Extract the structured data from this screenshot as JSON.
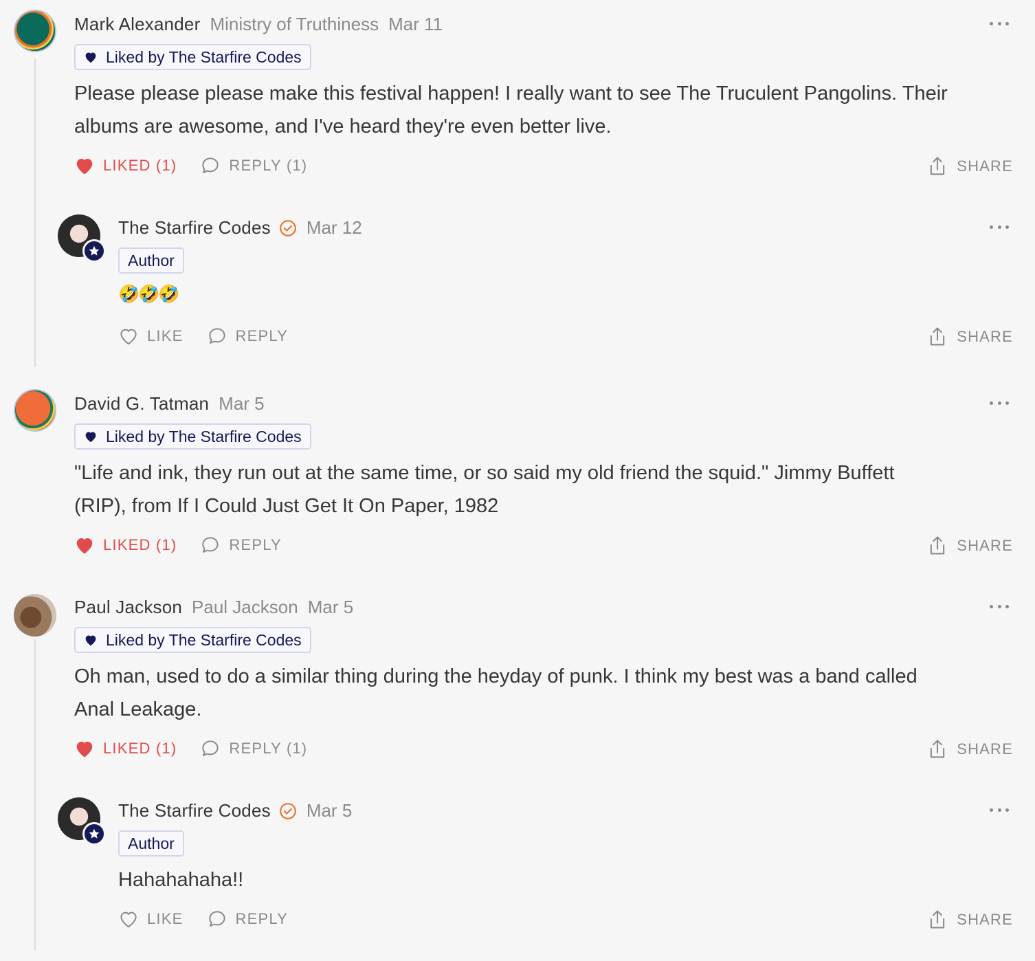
{
  "comments": [
    {
      "name": "Mark Alexander",
      "publication": "Ministry of Truthiness",
      "date": "Mar 11",
      "liked_badge": "Liked by The Starfire Codes",
      "text_lines": [
        "Please please please make this festival happen! I really want to see The Truculent Pangolins. Their",
        "albums are awesome, and I've heard they're even better live."
      ],
      "like_label": "LIKED (1)",
      "reply_label": "REPLY (1)",
      "share_label": "SHARE",
      "avatar_colors": [
        "#0b6b5a",
        "#e8742a"
      ]
    },
    {
      "name": "The Starfire Codes",
      "date": "Mar 12",
      "role": "Author",
      "text": "🤣🤣🤣",
      "like_label": "LIKE",
      "reply_label": "REPLY",
      "share_label": "SHARE"
    },
    {
      "name": "David G. Tatman",
      "date": "Mar 5",
      "liked_badge": "Liked by The Starfire Codes",
      "text_lines": [
        "\"Life and ink, they run out at the same time, or so said my old friend the squid.\" Jimmy Buffett",
        "(RIP), from If I Could Just Get It On Paper, 1982"
      ],
      "like_label": "LIKED (1)",
      "reply_label": "REPLY",
      "share_label": "SHARE",
      "avatar_colors": [
        "#f06c3a",
        "#1f7a55"
      ]
    },
    {
      "name": "Paul Jackson",
      "publication": "Paul Jackson",
      "date": "Mar 5",
      "liked_badge": "Liked by The Starfire Codes",
      "text_lines": [
        "Oh man, used to do a similar thing during the heyday of punk. I think my best was a band called",
        "Anal Leakage."
      ],
      "like_label": "LIKED (1)",
      "reply_label": "REPLY (1)",
      "share_label": "SHARE"
    },
    {
      "name": "The Starfire Codes",
      "date": "Mar 5",
      "role": "Author",
      "text": "Hahahahaha!!",
      "like_label": "LIKE",
      "reply_label": "REPLY",
      "share_label": "SHARE"
    }
  ],
  "colors": {
    "liked": "#e14b4b",
    "verified": "#e8742a",
    "badge_text": "#151a57"
  },
  "icons": [
    "heart-filled-icon",
    "heart-outline-icon",
    "comment-bubble-icon",
    "share-icon",
    "more-dots-icon",
    "verified-check-icon",
    "star-icon"
  ]
}
